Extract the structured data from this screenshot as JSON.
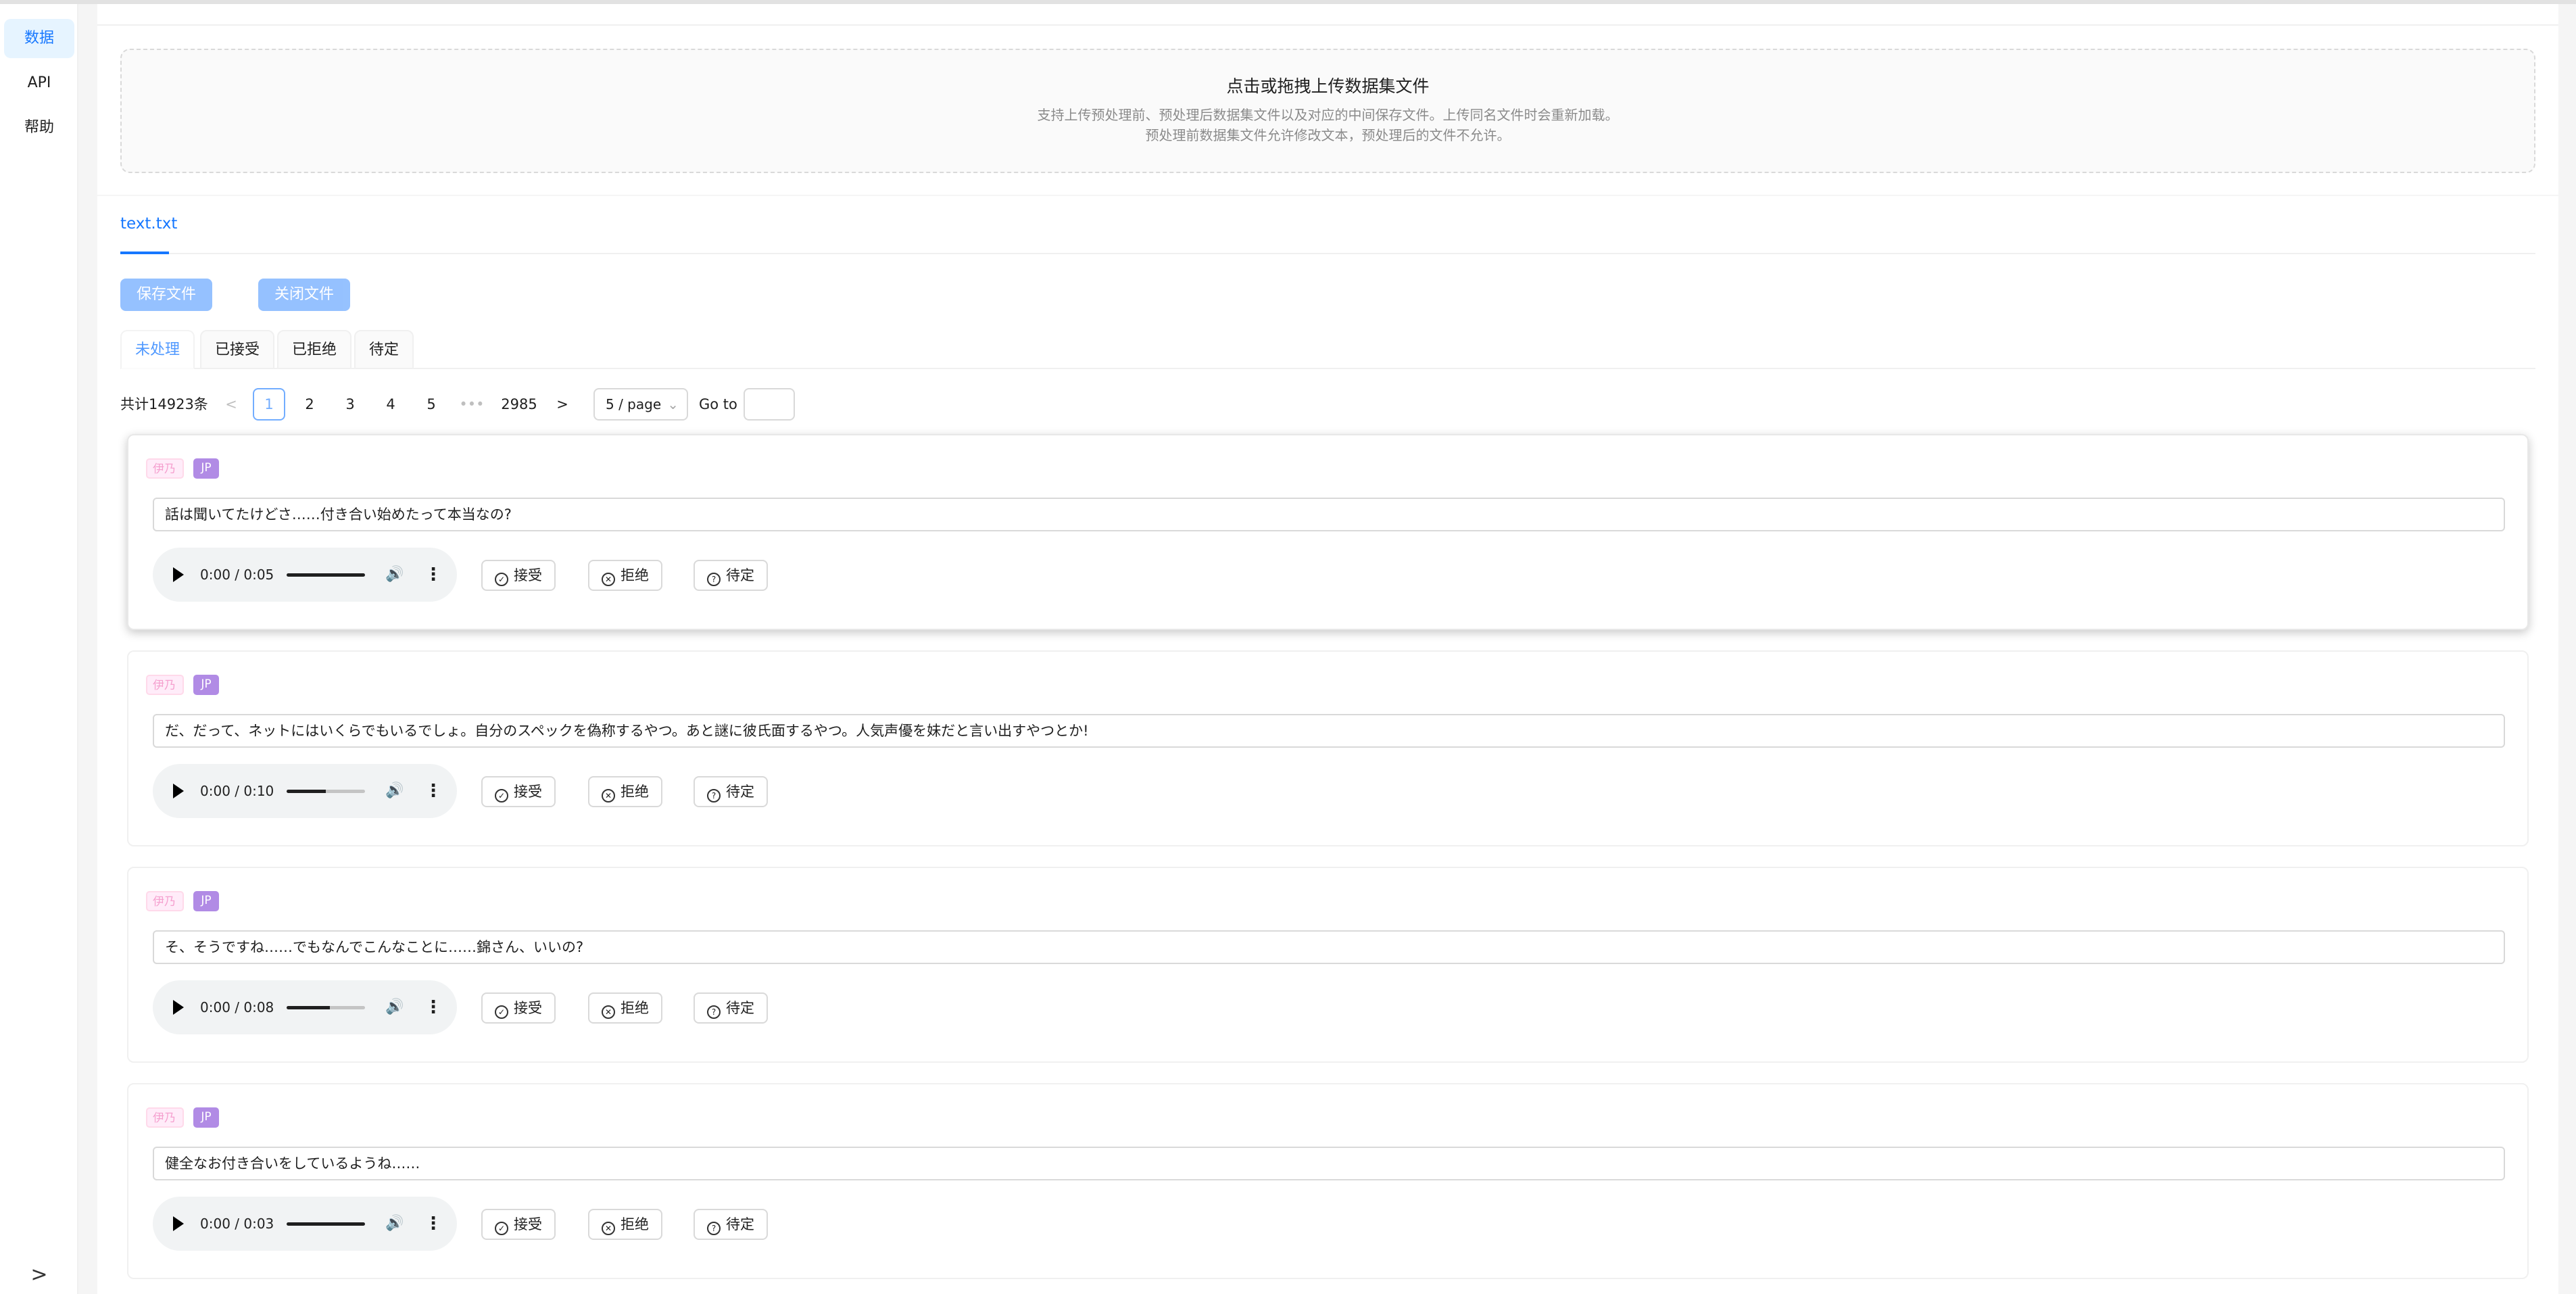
{
  "sidebar": {
    "items": [
      {
        "label": "数据",
        "active": true
      },
      {
        "label": "API",
        "active": false
      },
      {
        "label": "帮助",
        "active": false
      }
    ],
    "collapse_glyph": ">"
  },
  "upload": {
    "title": "点击或拖拽上传数据集文件",
    "hint_line1": "支持上传预处理前、预处理后数据集文件以及对应的中间保存文件。上传同名文件时会重新加载。",
    "hint_line2": "预处理前数据集文件允许修改文本，预处理后的文件不允许。"
  },
  "file_tab": {
    "label": "text.txt"
  },
  "toolbar": {
    "save_label": "保存文件",
    "close_label": "关闭文件"
  },
  "status_tabs": [
    {
      "label": "未处理",
      "active": true
    },
    {
      "label": "已接受",
      "active": false
    },
    {
      "label": "已拒绝",
      "active": false
    },
    {
      "label": "待定",
      "active": false
    }
  ],
  "pagination": {
    "total_text": "共计14923条",
    "prev": "<",
    "pages": [
      "1",
      "2",
      "3",
      "4",
      "5"
    ],
    "ellipsis": "•••",
    "last_page": "2985",
    "next": ">",
    "page_size": "5 / page",
    "size_chevron": "⌄",
    "goto_label": "Go to",
    "current": "1"
  },
  "items": [
    {
      "speaker": "伊乃",
      "lang": "JP",
      "text": "話は聞いてたけどさ……付き合い始めたって本当なの?",
      "time": "0:00 / 0:05",
      "progress": 1.0
    },
    {
      "speaker": "伊乃",
      "lang": "JP",
      "text": "だ、だって、ネットにはいくらでもいるでしょ。自分のスペックを偽称するやつ。あと謎に彼氏面するやつ。人気声優を妹だと言い出すやつとか!",
      "time": "0:00 / 0:10",
      "progress": 0.5
    },
    {
      "speaker": "伊乃",
      "lang": "JP",
      "text": "そ、そうですね……でもなんでこんなことに……錦さん、いいの?",
      "time": "0:00 / 0:08",
      "progress": 0.55
    },
    {
      "speaker": "伊乃",
      "lang": "JP",
      "text": "健全なお付き合いをしているようね……",
      "time": "0:00 / 0:03",
      "progress": 1.0
    }
  ],
  "actions": {
    "accept": "接受",
    "reject": "拒绝",
    "pending": "待定"
  },
  "icons": {
    "play": "play-icon",
    "volume": "volume-icon",
    "more": "more-vertical-icon",
    "accept": "check-circle-icon",
    "reject": "close-circle-icon",
    "pending": "question-circle-icon"
  },
  "colors": {
    "primary": "#1677ff",
    "speaker_tag": "#eb2f96",
    "lang_tag": "#722ed1"
  }
}
